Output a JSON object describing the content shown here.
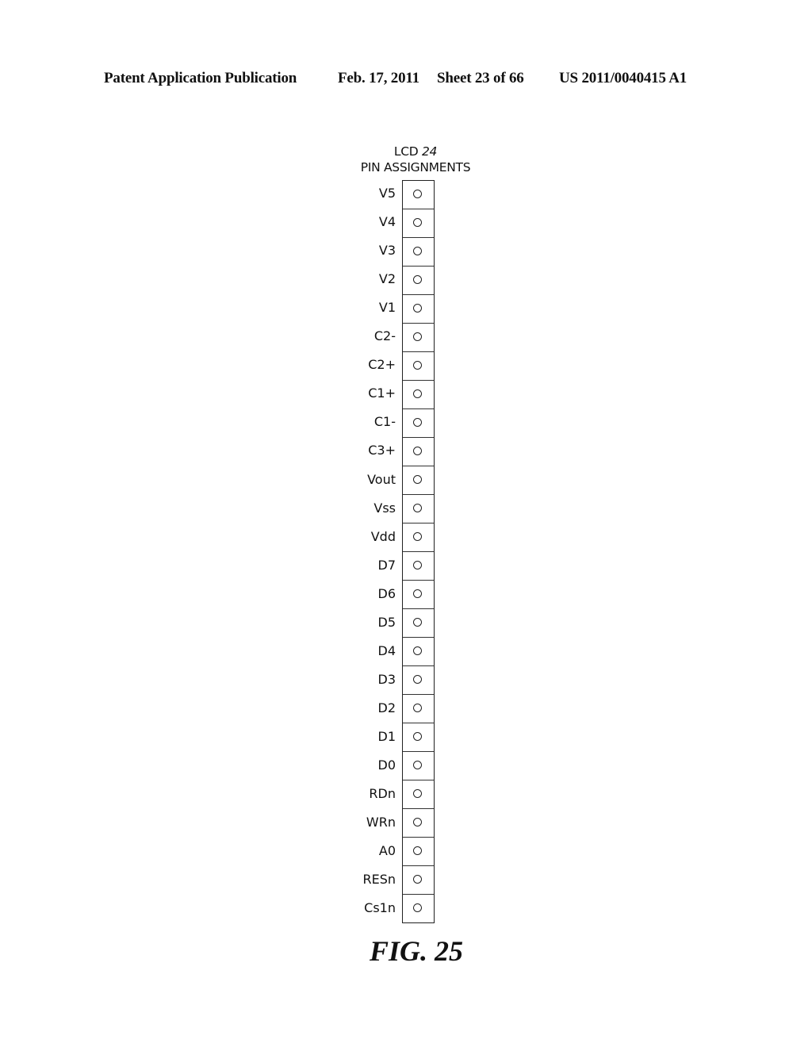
{
  "header": {
    "publication": "Patent Application Publication",
    "date": "Feb. 17, 2011",
    "sheet": "Sheet 23 of 66",
    "number": "US 2011/0040415 A1"
  },
  "diagram": {
    "title_prefix": "LCD ",
    "title_ref": "24",
    "subtitle": "PIN ASSIGNMENTS",
    "pins": [
      "V5",
      "V4",
      "V3",
      "V2",
      "V1",
      "C2-",
      "C2+",
      "C1+",
      "C1-",
      "C3+",
      "Vout",
      "Vss",
      "Vdd",
      "D7",
      "D6",
      "D5",
      "D4",
      "D3",
      "D2",
      "D1",
      "D0",
      "RDn",
      "WRn",
      "A0",
      "RESn",
      "Cs1n"
    ]
  },
  "figure_label": "FIG. 25"
}
